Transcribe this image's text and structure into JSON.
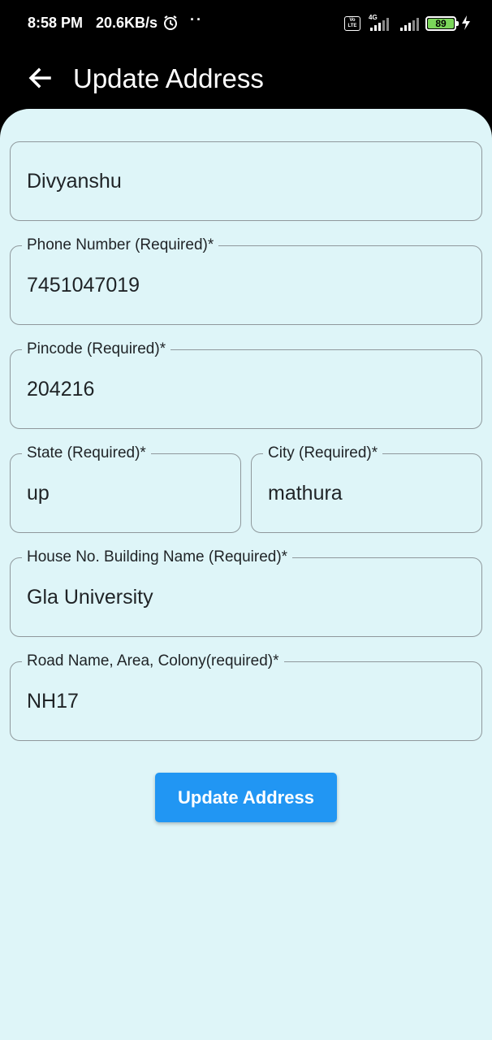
{
  "status_bar": {
    "time": "8:58 PM",
    "net_speed": "20.6KB/s",
    "dots": "··",
    "volte_line1": "Vo",
    "volte_line2": "LTE",
    "network_type": "4G",
    "battery_level": "89",
    "battery_color": "#7bd65a"
  },
  "app_bar": {
    "title": "Update Address",
    "back_icon": "arrow-left-icon"
  },
  "form": {
    "name": {
      "value": "Divyanshu"
    },
    "phone": {
      "label": "Phone Number (Required)*",
      "value": "7451047019"
    },
    "pincode": {
      "label": "Pincode (Required)*",
      "value": "204216"
    },
    "state": {
      "label": "State (Required)*",
      "value": "up"
    },
    "city": {
      "label": "City (Required)*",
      "value": "mathura"
    },
    "house": {
      "label": "House No. Building Name (Required)*",
      "value": "Gla University"
    },
    "road": {
      "label": "Road Name, Area, Colony(required)*",
      "value": "NH17"
    }
  },
  "submit_label": "Update Address",
  "colors": {
    "accent": "#2196f3",
    "panel_background": "#def5f8",
    "field_border": "#8f989c"
  }
}
